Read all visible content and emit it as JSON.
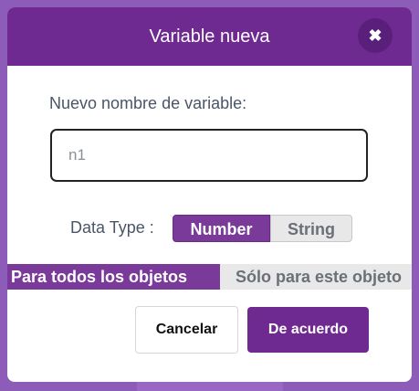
{
  "dialog": {
    "title": "Variable nueva",
    "close_icon": "close-icon",
    "close_glyph": "✖",
    "prompt": "Nuevo nombre de variable:",
    "name_input": {
      "value": "n1",
      "placeholder": ""
    },
    "data_type": {
      "label": "Data Type :",
      "options": [
        "Number",
        "String"
      ],
      "selected": "Number"
    },
    "scope": {
      "options": [
        "Para todos los objetos",
        "Sólo para este objeto"
      ],
      "selected": "Para todos los objetos"
    },
    "buttons": {
      "cancel": "Cancelar",
      "ok": "De acuerdo"
    }
  },
  "colors": {
    "accent": "#6f2a91",
    "selected_segment": "#7a3a9a",
    "backdrop": "#8d5bb8",
    "unselected_segment": "#e8e8e8"
  }
}
